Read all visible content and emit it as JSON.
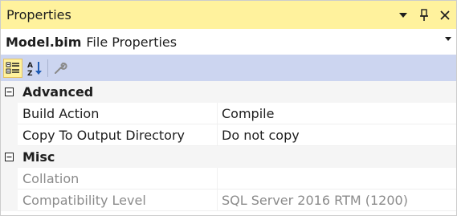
{
  "window": {
    "title": "Properties",
    "accent_color": "#fff29d",
    "buttons": [
      {
        "icon": "dropdown-arrow-icon"
      },
      {
        "icon": "pin-icon"
      },
      {
        "icon": "close-icon"
      }
    ]
  },
  "selector": {
    "object_name": "Model.bim",
    "object_type": "File Properties"
  },
  "toolbar": {
    "background": "#ccd5f0",
    "tools": [
      {
        "icon": "categorized-icon",
        "active": true
      },
      {
        "icon": "alphabetical-icon",
        "active": false
      },
      {
        "icon": "property-pages-wrench-icon",
        "active": false
      }
    ]
  },
  "grid": {
    "categories": [
      {
        "label": "Advanced",
        "properties": [
          {
            "name": "Build Action",
            "value": "Compile",
            "readonly": false
          },
          {
            "name": "Copy To Output Directory",
            "value": "Do not copy",
            "readonly": false
          }
        ]
      },
      {
        "label": "Misc",
        "properties": [
          {
            "name": "Collation",
            "value": "",
            "readonly": true
          },
          {
            "name": "Compatibility Level",
            "value": "SQL Server 2016 RTM (1200)",
            "readonly": true
          }
        ]
      }
    ]
  }
}
